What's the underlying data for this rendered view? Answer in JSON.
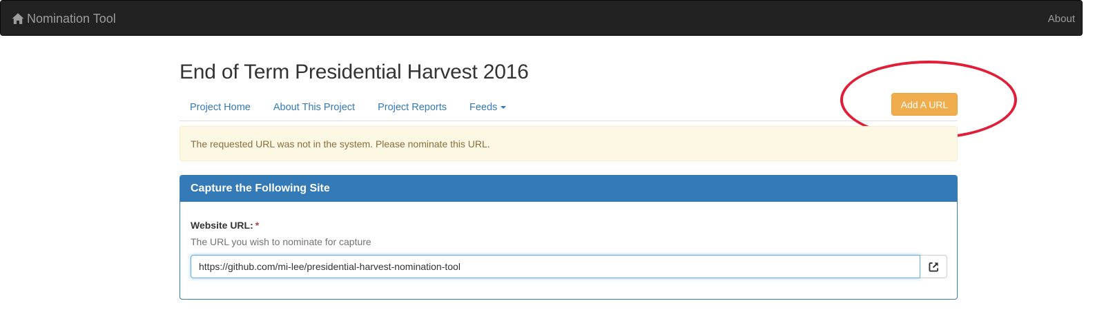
{
  "navbar": {
    "brand_label": "Nomination Tool",
    "brand_icon": "home-icon",
    "about_label": "About"
  },
  "project": {
    "title": "End of Term Presidential Harvest 2016"
  },
  "project_nav": {
    "items": [
      {
        "label": "Project Home"
      },
      {
        "label": "About This Project"
      },
      {
        "label": "Project Reports"
      },
      {
        "label": "Feeds"
      }
    ],
    "add_url_label": "Add A URL"
  },
  "alert": {
    "message": "The requested URL was not in the system. Please nominate this URL."
  },
  "panel": {
    "heading": "Capture the Following Site",
    "field_label": "Website URL:",
    "required_marker": "*",
    "help_text": "The URL you wish to nominate for capture",
    "url_value": "https://github.com/mi-lee/presidential-harvest-nomination-tool",
    "open_icon": "external-link-icon"
  },
  "colors": {
    "navbar_bg": "#222222",
    "link": "#337ab7",
    "warning_button": "#f0ad4e",
    "alert_bg": "#fcf8e3",
    "alert_text": "#8a6d3b",
    "panel_primary": "#337ab7",
    "annotation_circle": "#e11d38"
  }
}
